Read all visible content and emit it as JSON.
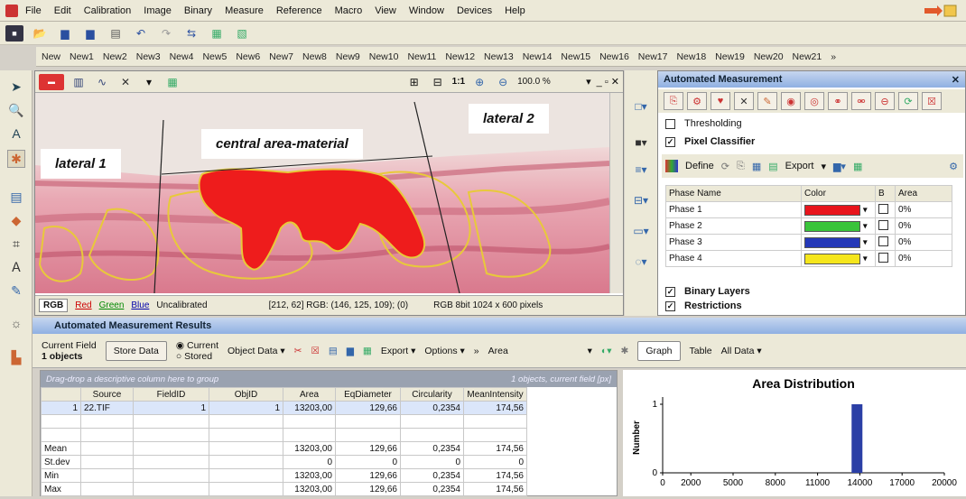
{
  "menu": [
    "File",
    "Edit",
    "Calibration",
    "Image",
    "Binary",
    "Measure",
    "Reference",
    "Macro",
    "View",
    "Window",
    "Devices",
    "Help"
  ],
  "doc_tabs": [
    "New",
    "New1",
    "New2",
    "New3",
    "New4",
    "New5",
    "New6",
    "New7",
    "New8",
    "New9",
    "New10",
    "New11",
    "New12",
    "New13",
    "New14",
    "New15",
    "New16",
    "New17",
    "New18",
    "New19",
    "New20",
    "New21",
    "»"
  ],
  "image_window": {
    "zoom": "100.0 %",
    "ratio_label": "1:1",
    "labels": {
      "lateral1": "lateral 1",
      "central": "central area-material",
      "lateral2": "lateral 2"
    },
    "status_tabs": [
      "RGB",
      "Red",
      "Green",
      "Blue"
    ],
    "status_uncal": "Uncalibrated",
    "status_coords": "[212, 62] RGB: (146, 125, 109); (0)",
    "status_info": "RGB 8bit 1024 x 600 pixels"
  },
  "auto_measure": {
    "title": "Automated Measurement",
    "thresholding": "Thresholding",
    "pixel_classifier": "Pixel Classifier",
    "define": "Define",
    "export": "Export",
    "phase_headers": [
      "Phase Name",
      "Color",
      "B",
      "Area"
    ],
    "phases": [
      {
        "name": "Phase 1",
        "color": "#e8141c",
        "area": "0%"
      },
      {
        "name": "Phase 2",
        "color": "#39c43a",
        "area": "0%"
      },
      {
        "name": "Phase 3",
        "color": "#2438b8",
        "area": "0%"
      },
      {
        "name": "Phase 4",
        "color": "#f5e61c",
        "area": "0%"
      }
    ],
    "binary_layers": "Binary Layers",
    "restrictions": "Restrictions"
  },
  "results": {
    "title": "Automated Measurement Results",
    "current_field_label": "Current Field",
    "objects_count": "1 objects",
    "store_data": "Store Data",
    "radio_current": "Current",
    "radio_stored": "Stored",
    "object_data": "Object Data",
    "export": "Export",
    "options": "Options",
    "area_select": "Area",
    "graph": "Graph",
    "table": "Table",
    "all_data": "All Data",
    "grid_hint": "Drag-drop a descriptive column here to group",
    "grid_status": "1 objects, current field [px]",
    "columns": [
      "",
      "Source",
      "FieldID",
      "ObjID",
      "Area",
      "EqDiameter",
      "Circularity",
      "MeanIntensity"
    ],
    "rows": [
      [
        "1",
        "22.TIF",
        "1",
        "1",
        "13203,00",
        "129,66",
        "0,2354",
        "174,56"
      ]
    ],
    "stats": [
      [
        "Mean",
        "",
        "",
        "",
        "13203,00",
        "129,66",
        "0,2354",
        "174,56"
      ],
      [
        "St.dev",
        "",
        "",
        "",
        "0",
        "0",
        "0",
        "0"
      ],
      [
        "Min",
        "",
        "",
        "",
        "13203,00",
        "129,66",
        "0,2354",
        "174,56"
      ],
      [
        "Max",
        "",
        "",
        "",
        "13203,00",
        "129,66",
        "0,2354",
        "174,56"
      ]
    ]
  },
  "chart_data": {
    "type": "bar",
    "title": "Area Distribution",
    "ylabel": "Number",
    "xlabel": "",
    "xlim": [
      0,
      20000
    ],
    "ylim": [
      0,
      1
    ],
    "x_ticks": [
      "0",
      "2000",
      "5000",
      "8000",
      "11000",
      "14000",
      "17000",
      "20000"
    ],
    "y_ticks": [
      "0",
      "1"
    ],
    "bins": [
      {
        "x": 13800,
        "value": 1
      }
    ],
    "bar_color": "#2b3fa6"
  }
}
